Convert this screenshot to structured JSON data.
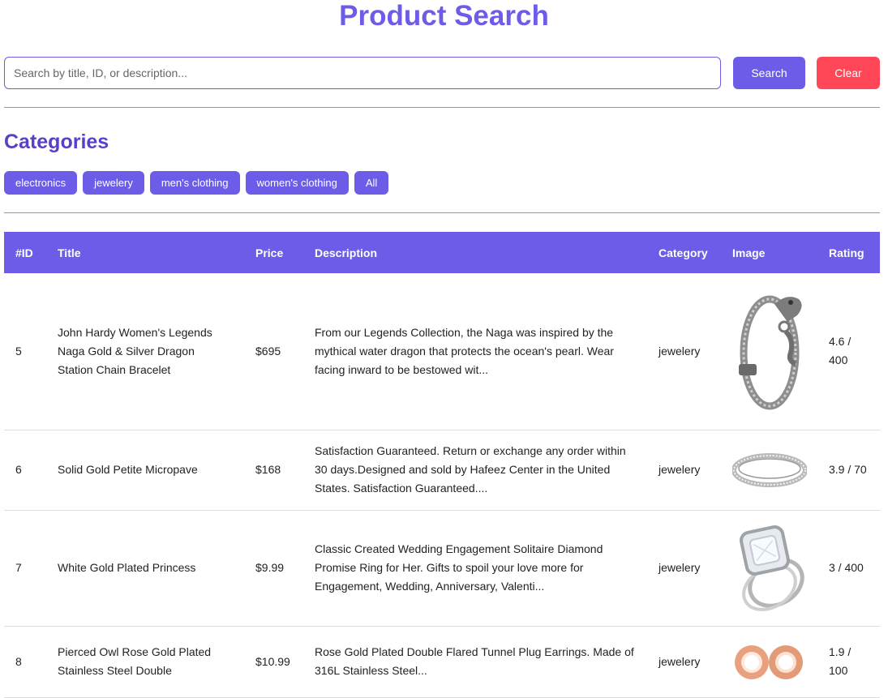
{
  "header": {
    "title": "Product Search"
  },
  "search": {
    "placeholder": "Search by title, ID, or description...",
    "value": "",
    "search_label": "Search",
    "clear_label": "Clear"
  },
  "categories": {
    "heading": "Categories",
    "items": [
      {
        "label": "electronics"
      },
      {
        "label": "jewelery"
      },
      {
        "label": "men's clothing"
      },
      {
        "label": "women's clothing"
      },
      {
        "label": "All"
      }
    ]
  },
  "table": {
    "headers": [
      "#ID",
      "Title",
      "Price",
      "Description",
      "Category",
      "Image",
      "Rating"
    ],
    "rows": [
      {
        "id": "5",
        "title": "John Hardy Women's Legends Naga Gold & Silver Dragon Station Chain Bracelet",
        "price": "$695",
        "description": "From our Legends Collection, the Naga was inspired by the mythical water dragon that protects the ocean's pearl. Wear facing inward to be bestowed wit...",
        "category": "jewelery",
        "image_icon": "dragon-bracelet-icon",
        "rating": "4.6 / 400"
      },
      {
        "id": "6",
        "title": "Solid Gold Petite Micropave",
        "price": "$168",
        "description": "Satisfaction Guaranteed. Return or exchange any order within 30 days.Designed and sold by Hafeez Center in the United States. Satisfaction Guaranteed....",
        "category": "jewelery",
        "image_icon": "ring-band-icon",
        "rating": "3.9 / 70"
      },
      {
        "id": "7",
        "title": "White Gold Plated Princess",
        "price": "$9.99",
        "description": "Classic Created Wedding Engagement Solitaire Diamond Promise Ring for Her. Gifts to spoil your love more for Engagement, Wedding, Anniversary, Valenti...",
        "category": "jewelery",
        "image_icon": "engagement-ring-icon",
        "rating": "3 / 400"
      },
      {
        "id": "8",
        "title": "Pierced Owl Rose Gold Plated Stainless Steel Double",
        "price": "$10.99",
        "description": "Rose Gold Plated Double Flared Tunnel Plug Earrings. Made of 316L Stainless Steel...",
        "category": "jewelery",
        "image_icon": "tunnel-earrings-icon",
        "rating": "1.9 / 100"
      }
    ]
  },
  "colors": {
    "primary": "#6c5ce7",
    "heading": "#5b3fc9",
    "clear": "#ff4757"
  }
}
